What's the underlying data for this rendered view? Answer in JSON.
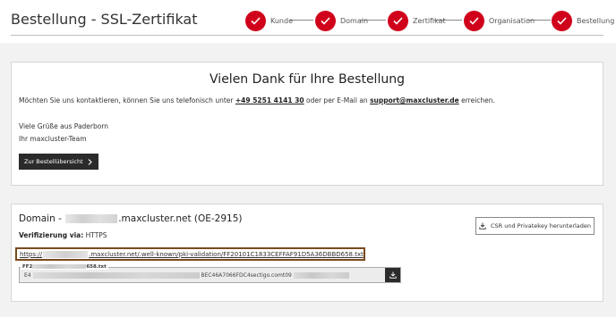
{
  "header": {
    "title": "Bestellung - SSL-Zertifikat"
  },
  "steps": [
    {
      "label": "Kunde",
      "icon": "check-icon"
    },
    {
      "label": "Domain",
      "icon": "check-icon"
    },
    {
      "label": "Zertifikat",
      "icon": "check-icon"
    },
    {
      "label": "Organisation",
      "icon": "check-icon"
    },
    {
      "label": "Bestellung",
      "icon": "check-icon"
    }
  ],
  "thanks": {
    "title": "Vielen Dank für Ihre Bestellung",
    "contact_prefix": "Möchten Sie uns kontaktieren, können Sie uns telefonisch unter",
    "phone": "+49 5251 4141 30",
    "contact_middle": "oder per E-Mail an",
    "email": "support@maxcluster.de",
    "contact_suffix": "erreichen.",
    "greeting_line1": "Viele Grüße aus Paderborn",
    "greeting_line2": "Ihr maxcluster-Team",
    "overview_button": "Zur Bestellübersicht"
  },
  "domain": {
    "title_prefix": "Domain -",
    "title_suffix": ".maxcluster.net (OE-2915)",
    "verification_label": "Verifizierung via:",
    "verification_value": "HTTPS",
    "csr_button": "CSR und Privatekey herunterladen",
    "url_prefix": "https://",
    "url_suffix": ".maxcluster.net/.well-known/pki-validation/FF20101C1833CEFFAF91D5A36DBBD658.txt",
    "file_label_prefix": "FF2",
    "file_label_suffix": "658.txt",
    "file_content_prefix": "E4",
    "file_content_middle": "BEC46A7066FDC4sectigo.comt09"
  },
  "colors": {
    "accent": "#d0021b",
    "dark_button": "#2b2b2b",
    "highlight_border": "#7a4a1e"
  }
}
